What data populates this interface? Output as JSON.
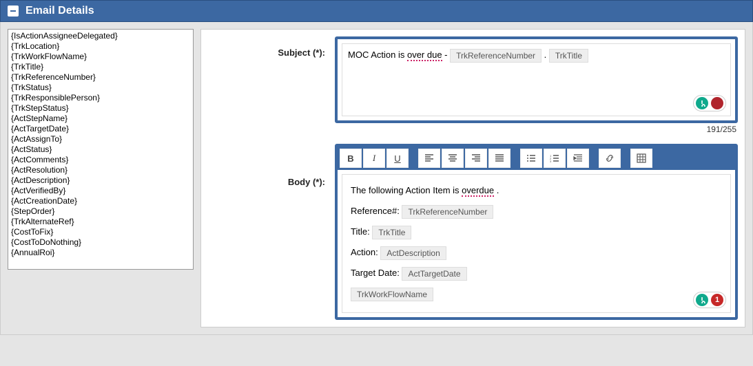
{
  "header": {
    "title": "Email Details"
  },
  "mergeFields": [
    "{IsActionAssigneeDelegated}",
    "{TrkLocation}",
    "{TrkWorkFlowName}",
    "{TrkTitle}",
    "{TrkReferenceNumber}",
    "{TrkStatus}",
    "{TrkResponsiblePerson}",
    "{TrkStepStatus}",
    "{ActStepName}",
    "{ActTargetDate}",
    "{ActAssignTo}",
    "{ActStatus}",
    "{ActComments}",
    "{ActResolution}",
    "{ActDescription}",
    "{ActVerifiedBy}",
    "{ActCreationDate}",
    "{StepOrder}",
    "{TrkAlternateRef}",
    "{CostToFix}",
    "{CostToDoNothing}",
    "{AnnualRoi}"
  ],
  "subject": {
    "label": "Subject (*):",
    "prefix1": "MOC Action is ",
    "typo": "over due",
    "sep1": " - ",
    "token1": "TrkReferenceNumber",
    "sep2": " . ",
    "token2": "TrkTitle",
    "counter": "191/255"
  },
  "body": {
    "label": "Body (*):",
    "line1a": "The following Action Item is ",
    "line1b": "overdue",
    "line1c": " .",
    "refLabel": "Reference#:",
    "refToken": "TrkReferenceNumber",
    "titleLabel": "Title:",
    "titleToken": "TrkTitle",
    "actionLabel": "Action:",
    "actionToken": "ActDescription",
    "targetLabel": "Target Date:",
    "targetToken": "ActTargetDate",
    "wfToken": "TrkWorkFlowName",
    "badge": "1"
  },
  "toolbar": {
    "bold": "B",
    "italic": "I",
    "underline": "U"
  }
}
